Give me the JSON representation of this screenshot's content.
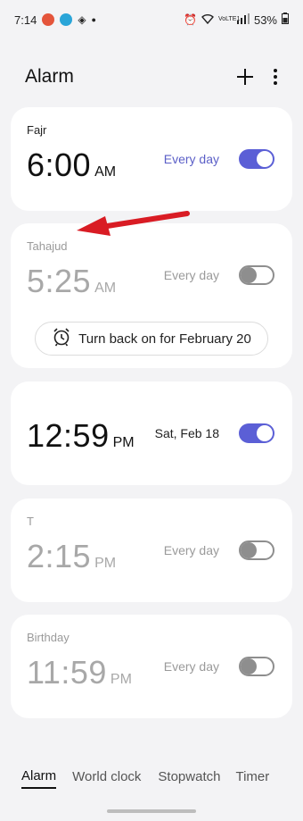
{
  "status_bar": {
    "time": "7:14",
    "battery": "53%",
    "network": "VoLTE1",
    "icons": [
      "notification-a-icon",
      "notification-b-icon",
      "notification-c-icon",
      "alarm-icon",
      "wifi-icon",
      "signal-icon",
      "battery-icon"
    ]
  },
  "header": {
    "title": "Alarm",
    "add_icon": "plus-icon",
    "more_icon": "more-vertical-icon"
  },
  "alarms": [
    {
      "label": "Fajr",
      "time": "6:00",
      "ampm": "AM",
      "repeat": "Every day",
      "enabled": true
    },
    {
      "label": "Tahajud",
      "time": "5:25",
      "ampm": "AM",
      "repeat": "Every day",
      "enabled": false,
      "button": "Turn back on for February 20"
    },
    {
      "label": "",
      "time": "12:59",
      "ampm": "PM",
      "repeat": "Sat, Feb 18",
      "enabled": true
    },
    {
      "label": "T",
      "time": "2:15",
      "ampm": "PM",
      "repeat": "Every day",
      "enabled": false
    },
    {
      "label": "Birthday",
      "time": "11:59",
      "ampm": "PM",
      "repeat": "Every day",
      "enabled": false
    }
  ],
  "tabs": [
    "Alarm",
    "World clock",
    "Stopwatch",
    "Timer"
  ],
  "active_tab": "Alarm",
  "colors": {
    "accent": "#5b5fd6",
    "annotation_arrow": "#d91c24",
    "background": "#f3f3f5"
  }
}
